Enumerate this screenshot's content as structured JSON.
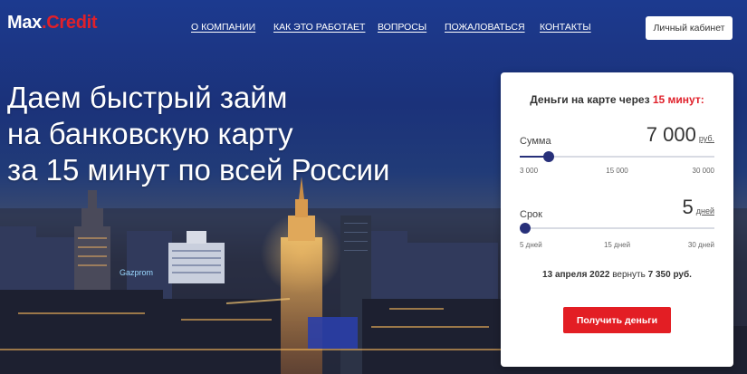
{
  "brand": {
    "name_part1": "Max",
    "name_dot": ".",
    "name_part2": "Credit"
  },
  "nav": [
    {
      "label": "О КОМПАНИИ"
    },
    {
      "label": "КАК ЭТО РАБОТАЕТ"
    },
    {
      "label": "ВОПРОСЫ"
    },
    {
      "label": "ПОЖАЛОВАТЬСЯ"
    },
    {
      "label": "КОНТАКТЫ"
    }
  ],
  "cabinet_label": "Личный кабинет",
  "headline": {
    "line1": "Даем быстрый займ",
    "line2": "на банковскую карту",
    "line3": "за 15 минут по всей России"
  },
  "calculator": {
    "title_prefix": "Деньги на карте через ",
    "title_accent": "15 минут:",
    "amount": {
      "label": "Сумма",
      "value": "7 000",
      "unit": "руб.",
      "min_label": "3 000",
      "mid_label": "15 000",
      "max_label": "30 000",
      "slider_fraction": 0.15
    },
    "term": {
      "label": "Срок",
      "value": "5",
      "unit": "дней",
      "min_label": "5 дней",
      "mid_label": "15 дней",
      "max_label": "30 дней",
      "slider_fraction": 0.0
    },
    "summary_date": "13 апреля 2022",
    "summary_text": " вернуть ",
    "summary_amount": "7 350 руб.",
    "submit_label": "Получить деньги"
  },
  "colors": {
    "accent": "#e31e24",
    "slider": "#27307a"
  },
  "background_sign": "Gazprom"
}
